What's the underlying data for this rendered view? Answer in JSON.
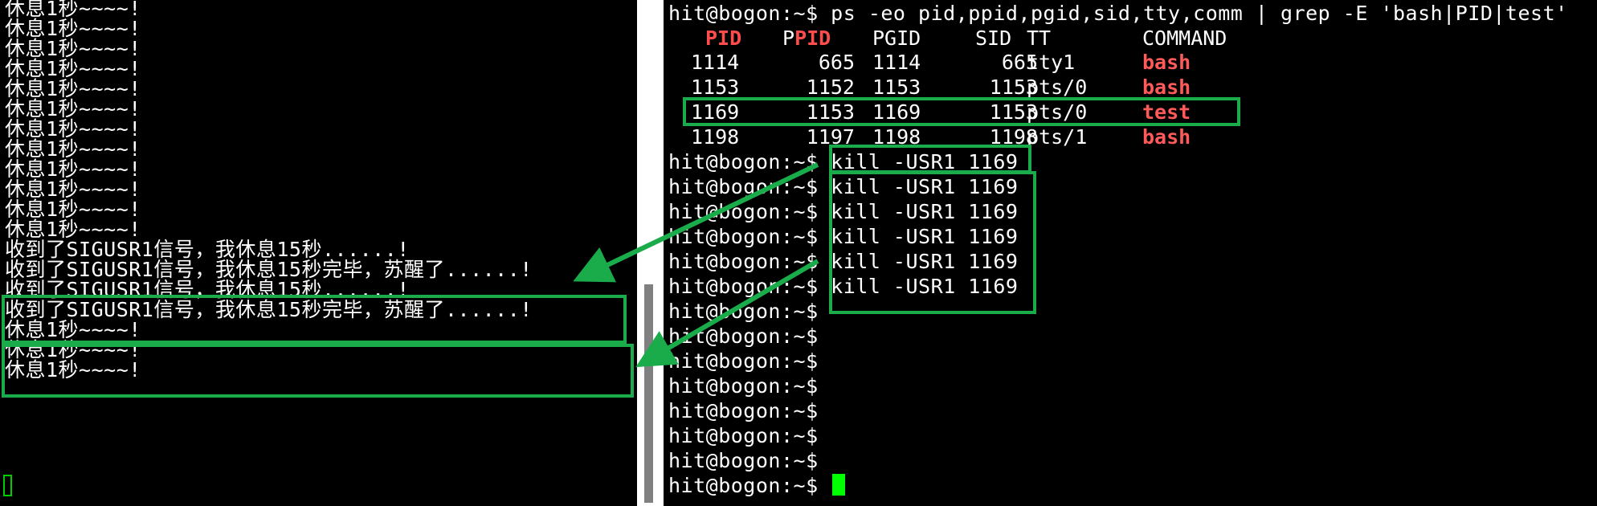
{
  "left_terminal": {
    "lines": [
      "休息1秒~~~~!",
      "休息1秒~~~~!",
      "休息1秒~~~~!",
      "休息1秒~~~~!",
      "休息1秒~~~~!",
      "休息1秒~~~~!",
      "休息1秒~~~~!",
      "休息1秒~~~~!",
      "休息1秒~~~~!",
      "休息1秒~~~~!",
      "休息1秒~~~~!",
      "休息1秒~~~~!",
      "收到了SIGUSR1信号，我休息15秒......!",
      "收到了SIGUSR1信号，我休息15秒完毕，苏醒了......!",
      "收到了SIGUSR1信号，我休息15秒......!",
      "收到了SIGUSR1信号，我休息15秒完毕，苏醒了......!",
      "休息1秒~~~~!",
      "休息1秒~~~~!",
      "休息1秒~~~~!"
    ]
  },
  "right_terminal": {
    "command_line": "hit@bogon:~$ ps -eo pid,ppid,pgid,sid,tty,comm | grep -E 'bash|PID|test'",
    "ps_header": {
      "pid": "PID",
      "ppid_p": "P",
      "ppid_rest": "PID",
      "pgid": "PGID",
      "sid": "SID",
      "tt": "TT",
      "command": "COMMAND"
    },
    "ps_rows": [
      {
        "pid": "1114",
        "ppid": "665",
        "pgid": "1114",
        "sid": "665",
        "tt": "tty1",
        "comm": "bash"
      },
      {
        "pid": "1153",
        "ppid": "1152",
        "pgid": "1153",
        "sid": "1153",
        "tt": "pts/0",
        "comm": "bash"
      },
      {
        "pid": "1169",
        "ppid": "1153",
        "pgid": "1169",
        "sid": "1153",
        "tt": "pts/0",
        "comm": "test"
      },
      {
        "pid": "1198",
        "ppid": "1197",
        "pgid": "1198",
        "sid": "1198",
        "tt": "pts/1",
        "comm": "bash"
      }
    ],
    "prompt": "hit@bogon:~$ ",
    "kill_commands": [
      "kill -USR1 1169",
      "kill -USR1 1169",
      "kill -USR1 1169",
      "kill -USR1 1169",
      "kill -USR1 1169",
      "kill -USR1 1169"
    ],
    "empty_prompts": [
      "hit@bogon:~$",
      "hit@bogon:~$",
      "hit@bogon:~$",
      "hit@bogon:~$",
      "hit@bogon:~$",
      "hit@bogon:~$",
      "hit@bogon:~$"
    ],
    "last_prompt": "hit@bogon:~$ "
  },
  "colors": {
    "highlight": "#1aab4a",
    "header_red": "#ff4d4d",
    "cursor": "#00ff00"
  },
  "icons": {
    "cursor_left": "hollow-block-cursor",
    "cursor_right": "solid-block-cursor"
  }
}
